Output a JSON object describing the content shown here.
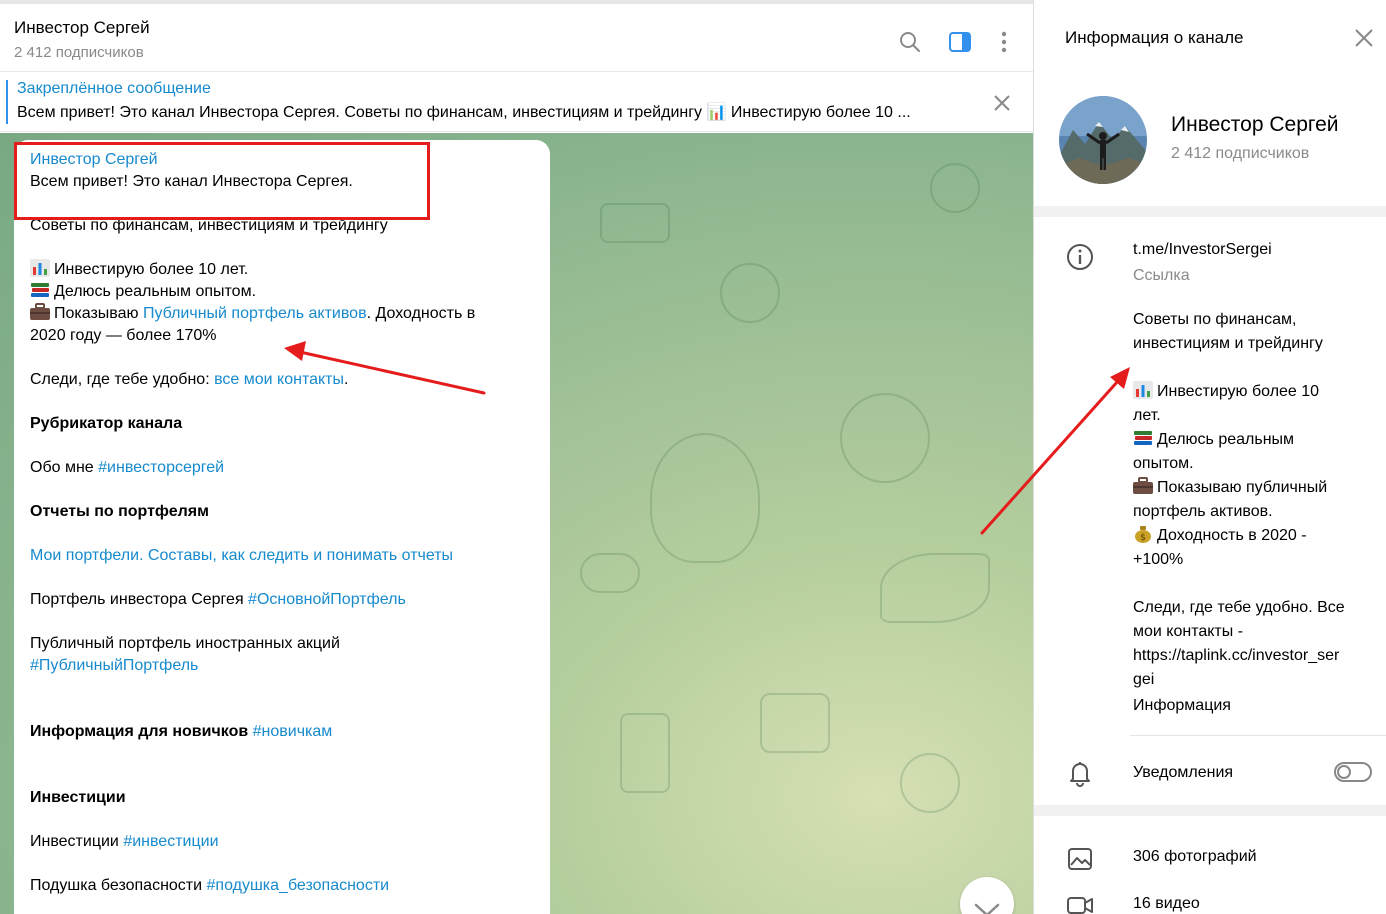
{
  "chat": {
    "title": "Инвестор Сергей",
    "subtitle": "2 412 подписчиков"
  },
  "header_icons": {
    "search": "search-icon",
    "sidebar": "sidebar-toggle-icon",
    "more": "more-vertical-icon"
  },
  "pinned": {
    "title": "Закреплённое сообщение",
    "text": "Всем привет! Это канал Инвестора Сергея.  Советы по финансам, инвестициям и трейдингу 📊 Инвестирую более 10 ..."
  },
  "message": {
    "author": "Инвестор Сергей",
    "greeting": "Всем привет! Это канал Инвестора Сергея.",
    "advice": "Советы по финансам, инвестициям и трейдингу",
    "line_invest": "Инвестирую более 10 лет.",
    "line_share": "Делюсь реальным опытом.",
    "line_show_prefix": "Показываю ",
    "line_show_link": "Публичный портфель активов",
    "line_show_suffix": ".  Доходность в",
    "line_2020": "2020 году — более 170%",
    "follow_prefix": "Следи, где тебе удобно: ",
    "follow_link": "все мои контакты",
    "follow_suffix": ".",
    "rubric": "Рубрикатор канала",
    "about_prefix": "Обо мне ",
    "about_tag": "#инвесторсергей",
    "reports": "Отчеты по портфелям",
    "portfolios_link": "Мои портфели. Составы, как следить и понимать отчеты",
    "sergey_prefix": "Портфель инвестора Сергея ",
    "sergey_tag": "#ОсновнойПортфель",
    "public_foreign": "Публичный портфель иностранных акций",
    "public_tag": "#ПубличныйПортфель",
    "newbies_prefix": "Информация для новичков ",
    "newbies_tag": "#новичкам",
    "investments_heading": "Инвестиции",
    "investments_prefix": "Инвестиции ",
    "investments_tag": "#инвестиции",
    "cushion_prefix": "Подушка безопасности ",
    "cushion_tag": "#подушка_безопасности"
  },
  "info": {
    "header": "Информация о канале",
    "name": "Инвестор Сергей",
    "subscribers": "2 412 подписчиков",
    "link": "t.me/InvestorSergei",
    "link_label": "Ссылка",
    "desc_1": "Советы по финансам,",
    "desc_2": "инвестициям и трейдингу",
    "desc_3": "Инвестирую более 10",
    "desc_4": "лет.",
    "desc_5": "Делюсь реальным",
    "desc_6": "опытом.",
    "desc_7": "Показываю публичный",
    "desc_8": "портфель активов.",
    "desc_9": "Доходность в 2020 -",
    "desc_10": "+100%",
    "desc_11": "Следи, где тебе удобно. Все",
    "desc_12": "мои контакты -",
    "desc_link_1": "https://taplink.cc/investor_ser",
    "desc_link_2": "gei",
    "desc_label": "Информация",
    "notifications": "Уведомления",
    "photos": "306 фотографий",
    "videos": "16 видео"
  },
  "colors": {
    "accent": "#168acd",
    "annotation": "#e51c1c"
  }
}
